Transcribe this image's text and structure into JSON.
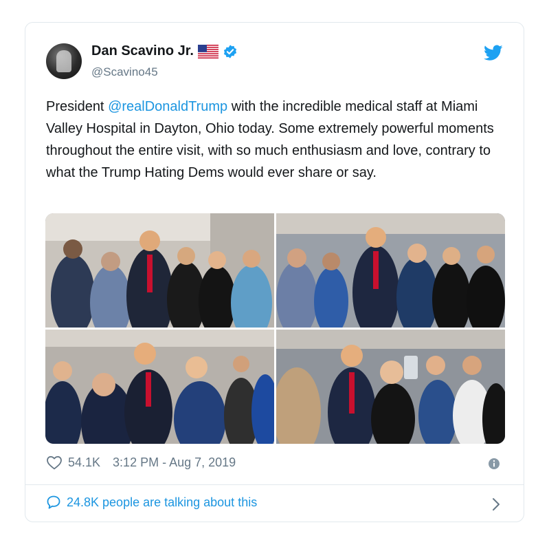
{
  "user": {
    "name": "Dan Scavino Jr.",
    "handle": "@Scavino45"
  },
  "icons": {
    "avatar": "profile-photo",
    "flag": "us-flag-icon",
    "verified": "verified-badge-icon",
    "brand": "twitter-bird-icon",
    "like": "heart-icon",
    "info": "info-icon",
    "reply": "speech-bubble-icon",
    "more": "chevron-right-icon"
  },
  "colors": {
    "accent": "#1b95e0",
    "twitter_blue": "#1da1f2",
    "muted": "#657786",
    "border": "#e1e8ed"
  },
  "tweet": {
    "text_before": "President ",
    "mention": "@realDonaldTrump",
    "text_after": " with the incredible medical staff at Miami Valley Hospital in Dayton, Ohio today. Some extremely powerful moments throughout the entire visit, with so much enthusiasm and love, contrary to what the Trump Hating Dems would ever share or say."
  },
  "stats": {
    "likes": "54.1K",
    "timestamp": "3:12 PM - Aug 7, 2019"
  },
  "conversation": {
    "label": "24.8K people are talking about this"
  }
}
